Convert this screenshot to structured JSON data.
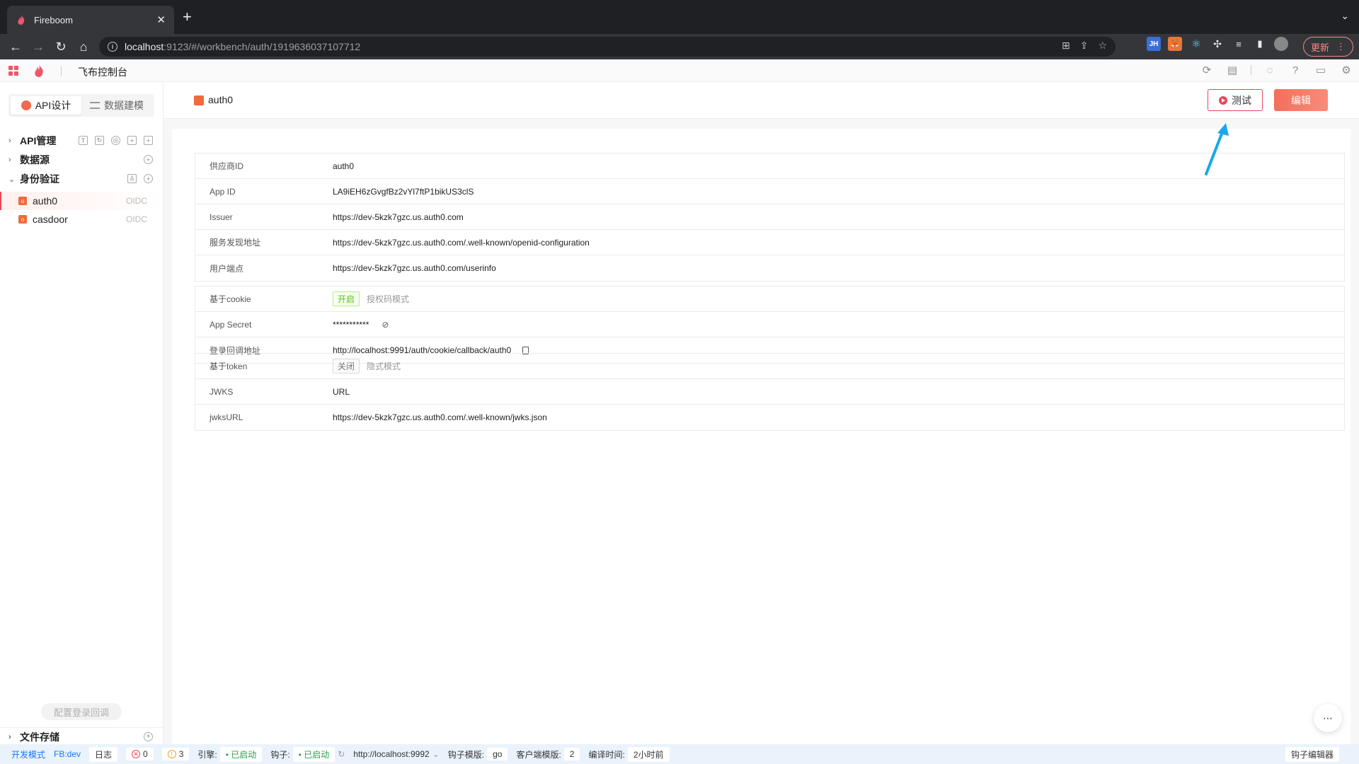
{
  "browser": {
    "tab_title": "Fireboom",
    "url_host": "localhost",
    "url_rest": ":9123/#/workbench/auth/1919636037107712",
    "update_label": "更新"
  },
  "app": {
    "title": "飞布控制台"
  },
  "sidebar": {
    "tabs": [
      {
        "label": "API设计"
      },
      {
        "label": "数据建模"
      }
    ],
    "sections": {
      "api": "API管理",
      "datasource": "数据源",
      "auth": "身份验证",
      "files": "文件存储"
    },
    "auth_items": [
      {
        "name": "auth0",
        "tag": "OIDC"
      },
      {
        "name": "casdoor",
        "tag": "OIDC"
      }
    ],
    "bottom_button": "配置登录回调"
  },
  "main": {
    "title": "auth0",
    "test_label": "测试",
    "edit_label": "编辑",
    "group1": [
      {
        "k": "供应商ID",
        "v": "auth0"
      },
      {
        "k": "App ID",
        "v": "LA9iEH6zGvgfBz2vYl7ftP1bikUS3clS"
      },
      {
        "k": "Issuer",
        "v": "https://dev-5kzk7gzc.us.auth0.com"
      },
      {
        "k": "服务发现地址",
        "v": "https://dev-5kzk7gzc.us.auth0.com/.well-known/openid-configuration"
      },
      {
        "k": "用户端点",
        "v": "https://dev-5kzk7gzc.us.auth0.com/userinfo"
      }
    ],
    "group2": {
      "cookie_key": "基于cookie",
      "cookie_tag": "开启",
      "cookie_mode": "授权码模式",
      "secret_key": "App Secret",
      "secret_val": "***********",
      "callback_key": "登录回调地址",
      "callback_val": "http://localhost:9991/auth/cookie/callback/auth0"
    },
    "group3": {
      "token_key": "基于token",
      "token_tag": "关闭",
      "token_mode": "隐式模式",
      "jwks_key": "JWKS",
      "jwks_val": "URL",
      "jwksurl_key": "jwksURL",
      "jwksurl_val": "https://dev-5kzk7gzc.us.auth0.com/.well-known/jwks.json"
    }
  },
  "status": {
    "mode": "开发模式",
    "env": "FB:dev",
    "log": "日志",
    "errors": "0",
    "warnings": "3",
    "engine_label": "引擎:",
    "engine_status": "• 已启动",
    "hook_label": "钩子:",
    "hook_status": "• 已启动",
    "hook_url": "http://localhost:9992",
    "hook_template_label": "钩子模版:",
    "hook_template": "go",
    "client_template_label": "客户端模版:",
    "client_template": "2",
    "compile_label": "编译时间:",
    "compile_time": "2小时前",
    "hook_editor": "钩子编辑器"
  },
  "colors": {
    "accent": "#e8475a",
    "edit_button": "#f36f5b",
    "arrow": "#1aa7ec"
  }
}
